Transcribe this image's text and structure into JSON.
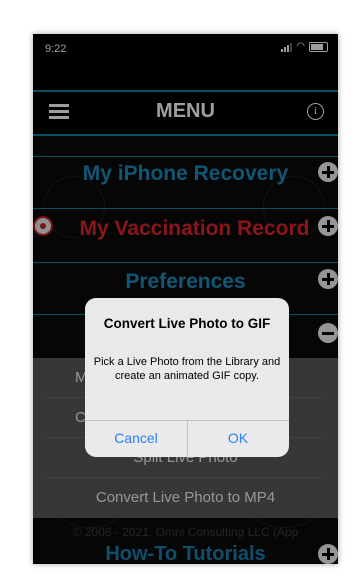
{
  "status_bar": {
    "time": "9:22"
  },
  "header": {
    "title": "MENU"
  },
  "menu": {
    "recovery": "My iPhone Recovery",
    "vaccination": "My Vaccination Record",
    "preferences": "Preferences",
    "tutorials": "How-To Tutorials"
  },
  "submenu": {
    "item1_partial": "M",
    "item2_partial": "C",
    "split": "Split Live Photo",
    "mp4": "Convert Live Photo to MP4"
  },
  "footer": {
    "copyright": "© 2008 - 2021, Omni Consulting LLC (App"
  },
  "dialog": {
    "title": "Convert Live Photo to GIF",
    "message": "Pick a Live Photo from the Library and create an animated GIF copy.",
    "cancel": "Cancel",
    "ok": "OK"
  },
  "colors": {
    "accent_blue": "#1a8bbd",
    "vaccine_red": "#e0242b",
    "ios_blue": "#2a7ff5"
  }
}
